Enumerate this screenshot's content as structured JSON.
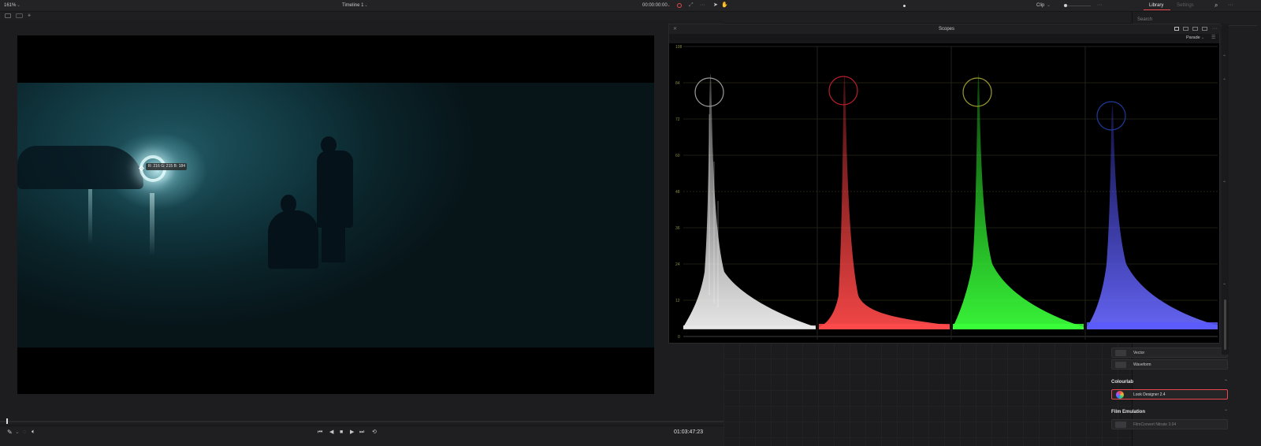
{
  "topbar": {
    "zoom": "161%",
    "timeline": "Timeline 1",
    "timecode": "00:00:00:00",
    "clip_label": "Clip",
    "tab_library": "Library",
    "tab_settings": "Settings"
  },
  "library": {
    "search_placeholder": "Search",
    "items_top": [
      "Vector",
      "Waveform"
    ],
    "section_colourlab": "Colourlab",
    "colourlab_item": "Look Designer 2.4",
    "section_film": "Film Emulation",
    "film_item": "FilmConvert Nitrate 3.04"
  },
  "viewer": {
    "pixel_readout": "R: 216 G: 215 B: 184"
  },
  "scopes": {
    "title": "Scopes",
    "mode": "Parade",
    "scale_ticks": [
      "108",
      "84",
      "72",
      "60",
      "48",
      "36",
      "24",
      "12",
      "0"
    ]
  },
  "transport": {
    "timecode": "01:03:47:23"
  },
  "colors": {
    "accent_red": "#e5484d",
    "scope_white": "#e8e8e8",
    "scope_red": "#ff4a4a",
    "scope_green": "#3bff3b",
    "scope_blue": "#5a5aff"
  }
}
